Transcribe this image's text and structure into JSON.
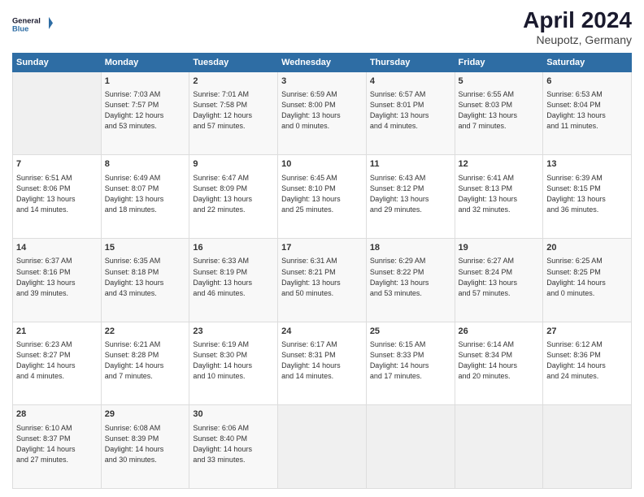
{
  "header": {
    "logo_line1": "General",
    "logo_line2": "Blue",
    "title": "April 2024",
    "subtitle": "Neupotz, Germany"
  },
  "columns": [
    "Sunday",
    "Monday",
    "Tuesday",
    "Wednesday",
    "Thursday",
    "Friday",
    "Saturday"
  ],
  "weeks": [
    {
      "days": [
        {
          "num": "",
          "info": "",
          "empty": true
        },
        {
          "num": "1",
          "info": "Sunrise: 7:03 AM\nSunset: 7:57 PM\nDaylight: 12 hours\nand 53 minutes."
        },
        {
          "num": "2",
          "info": "Sunrise: 7:01 AM\nSunset: 7:58 PM\nDaylight: 12 hours\nand 57 minutes."
        },
        {
          "num": "3",
          "info": "Sunrise: 6:59 AM\nSunset: 8:00 PM\nDaylight: 13 hours\nand 0 minutes."
        },
        {
          "num": "4",
          "info": "Sunrise: 6:57 AM\nSunset: 8:01 PM\nDaylight: 13 hours\nand 4 minutes."
        },
        {
          "num": "5",
          "info": "Sunrise: 6:55 AM\nSunset: 8:03 PM\nDaylight: 13 hours\nand 7 minutes."
        },
        {
          "num": "6",
          "info": "Sunrise: 6:53 AM\nSunset: 8:04 PM\nDaylight: 13 hours\nand 11 minutes."
        }
      ]
    },
    {
      "days": [
        {
          "num": "7",
          "info": "Sunrise: 6:51 AM\nSunset: 8:06 PM\nDaylight: 13 hours\nand 14 minutes."
        },
        {
          "num": "8",
          "info": "Sunrise: 6:49 AM\nSunset: 8:07 PM\nDaylight: 13 hours\nand 18 minutes."
        },
        {
          "num": "9",
          "info": "Sunrise: 6:47 AM\nSunset: 8:09 PM\nDaylight: 13 hours\nand 22 minutes."
        },
        {
          "num": "10",
          "info": "Sunrise: 6:45 AM\nSunset: 8:10 PM\nDaylight: 13 hours\nand 25 minutes."
        },
        {
          "num": "11",
          "info": "Sunrise: 6:43 AM\nSunset: 8:12 PM\nDaylight: 13 hours\nand 29 minutes."
        },
        {
          "num": "12",
          "info": "Sunrise: 6:41 AM\nSunset: 8:13 PM\nDaylight: 13 hours\nand 32 minutes."
        },
        {
          "num": "13",
          "info": "Sunrise: 6:39 AM\nSunset: 8:15 PM\nDaylight: 13 hours\nand 36 minutes."
        }
      ]
    },
    {
      "days": [
        {
          "num": "14",
          "info": "Sunrise: 6:37 AM\nSunset: 8:16 PM\nDaylight: 13 hours\nand 39 minutes."
        },
        {
          "num": "15",
          "info": "Sunrise: 6:35 AM\nSunset: 8:18 PM\nDaylight: 13 hours\nand 43 minutes."
        },
        {
          "num": "16",
          "info": "Sunrise: 6:33 AM\nSunset: 8:19 PM\nDaylight: 13 hours\nand 46 minutes."
        },
        {
          "num": "17",
          "info": "Sunrise: 6:31 AM\nSunset: 8:21 PM\nDaylight: 13 hours\nand 50 minutes."
        },
        {
          "num": "18",
          "info": "Sunrise: 6:29 AM\nSunset: 8:22 PM\nDaylight: 13 hours\nand 53 minutes."
        },
        {
          "num": "19",
          "info": "Sunrise: 6:27 AM\nSunset: 8:24 PM\nDaylight: 13 hours\nand 57 minutes."
        },
        {
          "num": "20",
          "info": "Sunrise: 6:25 AM\nSunset: 8:25 PM\nDaylight: 14 hours\nand 0 minutes."
        }
      ]
    },
    {
      "days": [
        {
          "num": "21",
          "info": "Sunrise: 6:23 AM\nSunset: 8:27 PM\nDaylight: 14 hours\nand 4 minutes."
        },
        {
          "num": "22",
          "info": "Sunrise: 6:21 AM\nSunset: 8:28 PM\nDaylight: 14 hours\nand 7 minutes."
        },
        {
          "num": "23",
          "info": "Sunrise: 6:19 AM\nSunset: 8:30 PM\nDaylight: 14 hours\nand 10 minutes."
        },
        {
          "num": "24",
          "info": "Sunrise: 6:17 AM\nSunset: 8:31 PM\nDaylight: 14 hours\nand 14 minutes."
        },
        {
          "num": "25",
          "info": "Sunrise: 6:15 AM\nSunset: 8:33 PM\nDaylight: 14 hours\nand 17 minutes."
        },
        {
          "num": "26",
          "info": "Sunrise: 6:14 AM\nSunset: 8:34 PM\nDaylight: 14 hours\nand 20 minutes."
        },
        {
          "num": "27",
          "info": "Sunrise: 6:12 AM\nSunset: 8:36 PM\nDaylight: 14 hours\nand 24 minutes."
        }
      ]
    },
    {
      "days": [
        {
          "num": "28",
          "info": "Sunrise: 6:10 AM\nSunset: 8:37 PM\nDaylight: 14 hours\nand 27 minutes."
        },
        {
          "num": "29",
          "info": "Sunrise: 6:08 AM\nSunset: 8:39 PM\nDaylight: 14 hours\nand 30 minutes."
        },
        {
          "num": "30",
          "info": "Sunrise: 6:06 AM\nSunset: 8:40 PM\nDaylight: 14 hours\nand 33 minutes."
        },
        {
          "num": "",
          "info": "",
          "empty": true
        },
        {
          "num": "",
          "info": "",
          "empty": true
        },
        {
          "num": "",
          "info": "",
          "empty": true
        },
        {
          "num": "",
          "info": "",
          "empty": true
        }
      ]
    }
  ]
}
